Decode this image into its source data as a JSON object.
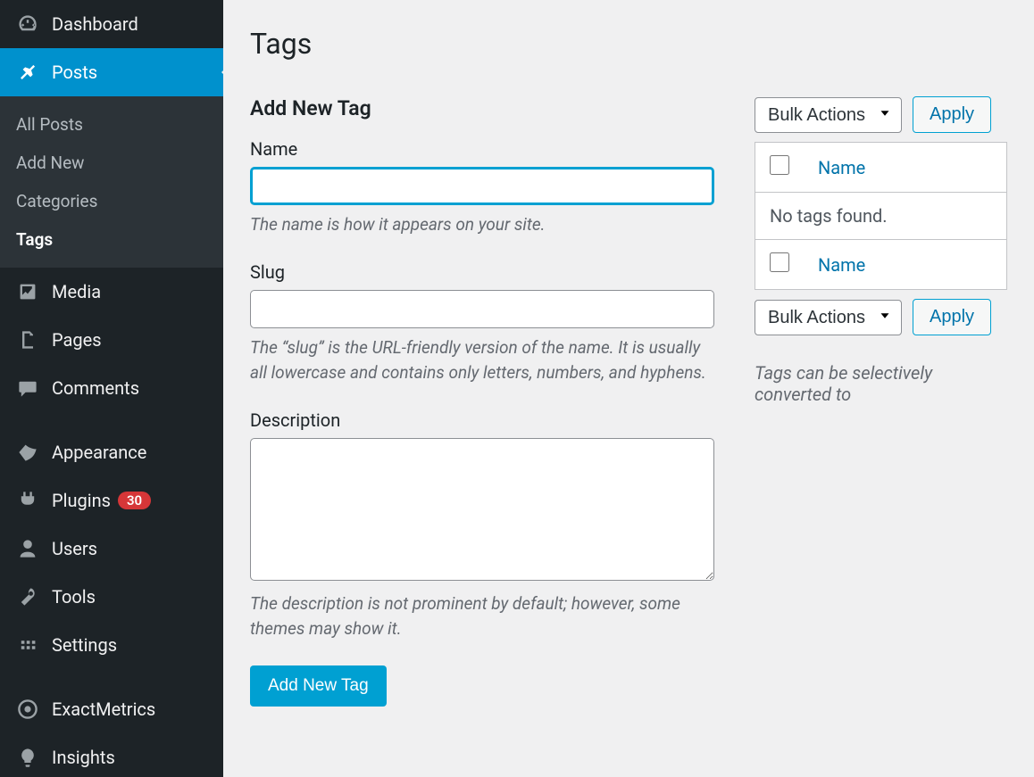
{
  "sidebar": {
    "dashboard": "Dashboard",
    "posts": "Posts",
    "posts_sub": {
      "all": "All Posts",
      "add": "Add New",
      "categories": "Categories",
      "tags": "Tags"
    },
    "media": "Media",
    "pages": "Pages",
    "comments": "Comments",
    "appearance": "Appearance",
    "plugins": "Plugins",
    "plugins_badge": "30",
    "users": "Users",
    "tools": "Tools",
    "settings": "Settings",
    "exactmetrics": "ExactMetrics",
    "insights": "Insights"
  },
  "page": {
    "title": "Tags"
  },
  "form": {
    "heading": "Add New Tag",
    "name_label": "Name",
    "name_hint": "The name is how it appears on your site.",
    "slug_label": "Slug",
    "slug_hint": "The “slug” is the URL-friendly version of the name. It is usually all lowercase and contains only letters, numbers, and hyphens.",
    "desc_label": "Description",
    "desc_hint": "The description is not prominent by default; however, some themes may show it.",
    "submit": "Add New Tag"
  },
  "table": {
    "bulk_label": "Bulk Actions",
    "apply": "Apply",
    "col_name": "Name",
    "empty": "No tags found."
  },
  "footer_note": "Tags can be selectively converted to"
}
